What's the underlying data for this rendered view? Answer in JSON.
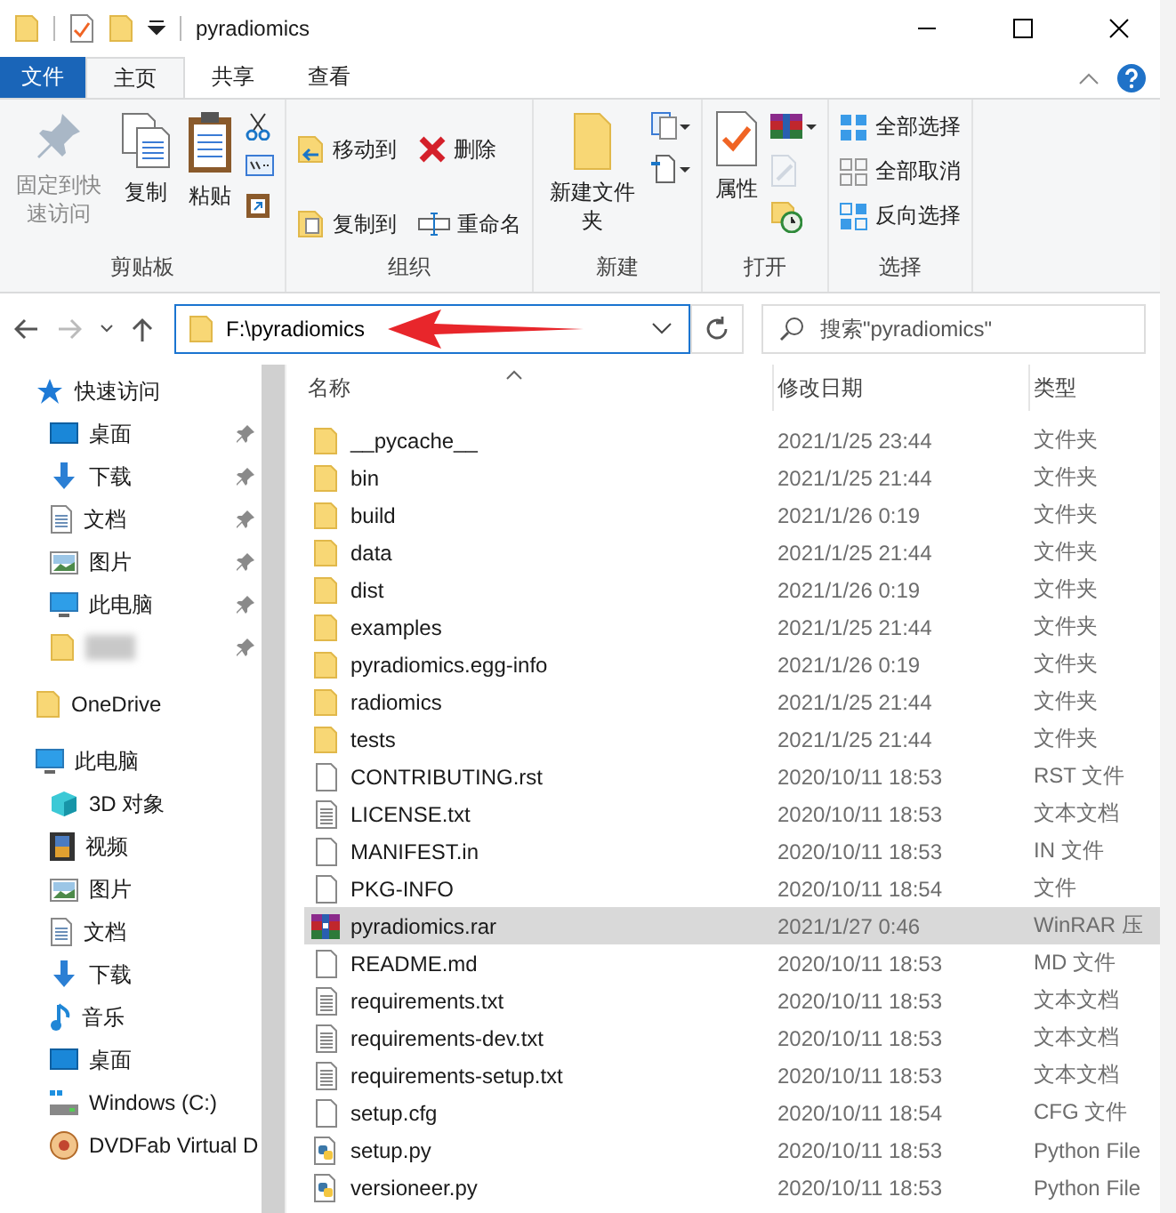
{
  "window": {
    "title": "pyradiomics"
  },
  "ribbon_tabs": [
    {
      "label": "文件",
      "kind": "file"
    },
    {
      "label": "主页",
      "kind": "tab",
      "selected": true
    },
    {
      "label": "共享",
      "kind": "tab",
      "selected": false
    },
    {
      "label": "查看",
      "kind": "tab",
      "selected": false
    }
  ],
  "ribbon_groups": [
    {
      "label": "剪贴板",
      "buttons": [
        {
          "label": "固定到快速访问",
          "kind": "pin",
          "disabled": true
        },
        {
          "label": "复制",
          "kind": "copy",
          "disabled": false
        },
        {
          "label": "粘贴",
          "kind": "paste",
          "disabled": false
        },
        {
          "kind": "cut"
        },
        {
          "kind": "path"
        },
        {
          "kind": "shortcut"
        }
      ]
    },
    {
      "label": "组织",
      "buttons": [
        {
          "label": "移动到",
          "kind": "move"
        },
        {
          "label": "复制到",
          "kind": "copyto"
        },
        {
          "label": "删除",
          "kind": "delete"
        },
        {
          "label": "重命名",
          "kind": "rename"
        }
      ]
    },
    {
      "label": "新建",
      "buttons": [
        {
          "label": "新建文件夹",
          "kind": "newfolder",
          "disabled": false
        },
        {
          "kind": "newitem"
        },
        {
          "kind": "easyaccess"
        }
      ]
    },
    {
      "label": "打开",
      "buttons": [
        {
          "label": "属性",
          "kind": "properties",
          "disabled": false
        },
        {
          "kind": "rar",
          "disabled": false
        },
        {
          "kind": "edit",
          "disabled": true
        },
        {
          "kind": "history",
          "disabled": false
        }
      ]
    },
    {
      "label": "选择",
      "buttons": [
        {
          "label": "全部选择",
          "kind": "selectall",
          "disabled": false
        },
        {
          "label": "全部取消",
          "kind": "selectnone",
          "disabled": false
        },
        {
          "label": "反向选择",
          "kind": "invert",
          "disabled": false
        }
      ]
    }
  ],
  "address": {
    "value": "F:\\pyradiomics"
  },
  "search": {
    "placeholder": "搜索\"pyradiomics\""
  },
  "sidebar": [
    {
      "label": "快速访问",
      "kind": "star",
      "children": [
        {
          "label": "桌面",
          "kind": "desktop",
          "pinned": true
        },
        {
          "label": "下载",
          "kind": "download",
          "pinned": true
        },
        {
          "label": "文档",
          "kind": "doc",
          "pinned": true
        },
        {
          "label": "图片",
          "kind": "picture",
          "pinned": true
        },
        {
          "label": "此电脑",
          "kind": "pc",
          "pinned": true
        },
        {
          "kind": "folder",
          "pinned": true
        }
      ]
    },
    {
      "label": "OneDrive",
      "kind": "folder"
    },
    {
      "label": "此电脑",
      "kind": "pc",
      "children": [
        {
          "label": "3D 对象",
          "kind": "cube"
        },
        {
          "label": "视频",
          "kind": "video"
        },
        {
          "label": "图片",
          "kind": "picture"
        },
        {
          "label": "文档",
          "kind": "doc"
        },
        {
          "label": "下载",
          "kind": "download"
        },
        {
          "label": "音乐",
          "kind": "music"
        },
        {
          "label": "桌面",
          "kind": "desktop"
        },
        {
          "label": "Windows (C:)",
          "kind": "drive"
        },
        {
          "label": "DVDFab Virtual D",
          "kind": "disc"
        }
      ]
    }
  ],
  "columns": [
    "名称",
    "修改日期",
    "类型"
  ],
  "files": [
    {
      "name": "__pycache__",
      "date": "2021/1/25 23:44",
      "type": "文件夹",
      "kind": "folder",
      "selected": false
    },
    {
      "name": "bin",
      "date": "2021/1/25 21:44",
      "type": "文件夹",
      "kind": "folder",
      "selected": false
    },
    {
      "name": "build",
      "date": "2021/1/26 0:19",
      "type": "文件夹",
      "kind": "folder",
      "selected": false
    },
    {
      "name": "data",
      "date": "2021/1/25 21:44",
      "type": "文件夹",
      "kind": "folder",
      "selected": false
    },
    {
      "name": "dist",
      "date": "2021/1/26 0:19",
      "type": "文件夹",
      "kind": "folder",
      "selected": false
    },
    {
      "name": "examples",
      "date": "2021/1/25 21:44",
      "type": "文件夹",
      "kind": "folder",
      "selected": false
    },
    {
      "name": "pyradiomics.egg-info",
      "date": "2021/1/26 0:19",
      "type": "文件夹",
      "kind": "folder",
      "selected": false
    },
    {
      "name": "radiomics",
      "date": "2021/1/25 21:44",
      "type": "文件夹",
      "kind": "folder",
      "selected": false
    },
    {
      "name": "tests",
      "date": "2021/1/25 21:44",
      "type": "文件夹",
      "kind": "folder",
      "selected": false
    },
    {
      "name": "CONTRIBUTING.rst",
      "date": "2020/10/11 18:53",
      "type": "RST 文件",
      "kind": "file",
      "selected": false
    },
    {
      "name": "LICENSE.txt",
      "date": "2020/10/11 18:53",
      "type": "文本文档",
      "kind": "text",
      "selected": false
    },
    {
      "name": "MANIFEST.in",
      "date": "2020/10/11 18:53",
      "type": "IN 文件",
      "kind": "file",
      "selected": false
    },
    {
      "name": "PKG-INFO",
      "date": "2020/10/11 18:54",
      "type": "文件",
      "kind": "file",
      "selected": false
    },
    {
      "name": "pyradiomics.rar",
      "date": "2021/1/27 0:46",
      "type": "WinRAR 压",
      "kind": "rar",
      "selected": true
    },
    {
      "name": "README.md",
      "date": "2020/10/11 18:53",
      "type": "MD 文件",
      "kind": "file",
      "selected": false
    },
    {
      "name": "requirements.txt",
      "date": "2020/10/11 18:53",
      "type": "文本文档",
      "kind": "text",
      "selected": false
    },
    {
      "name": "requirements-dev.txt",
      "date": "2020/10/11 18:53",
      "type": "文本文档",
      "kind": "text",
      "selected": false
    },
    {
      "name": "requirements-setup.txt",
      "date": "2020/10/11 18:53",
      "type": "文本文档",
      "kind": "text",
      "selected": false
    },
    {
      "name": "setup.cfg",
      "date": "2020/10/11 18:54",
      "type": "CFG 文件",
      "kind": "file",
      "selected": false
    },
    {
      "name": "setup.py",
      "date": "2020/10/11 18:53",
      "type": "Python File",
      "kind": "python",
      "selected": false
    },
    {
      "name": "versioneer.py",
      "date": "2020/10/11 18:53",
      "type": "Python File",
      "kind": "python",
      "selected": false
    }
  ]
}
